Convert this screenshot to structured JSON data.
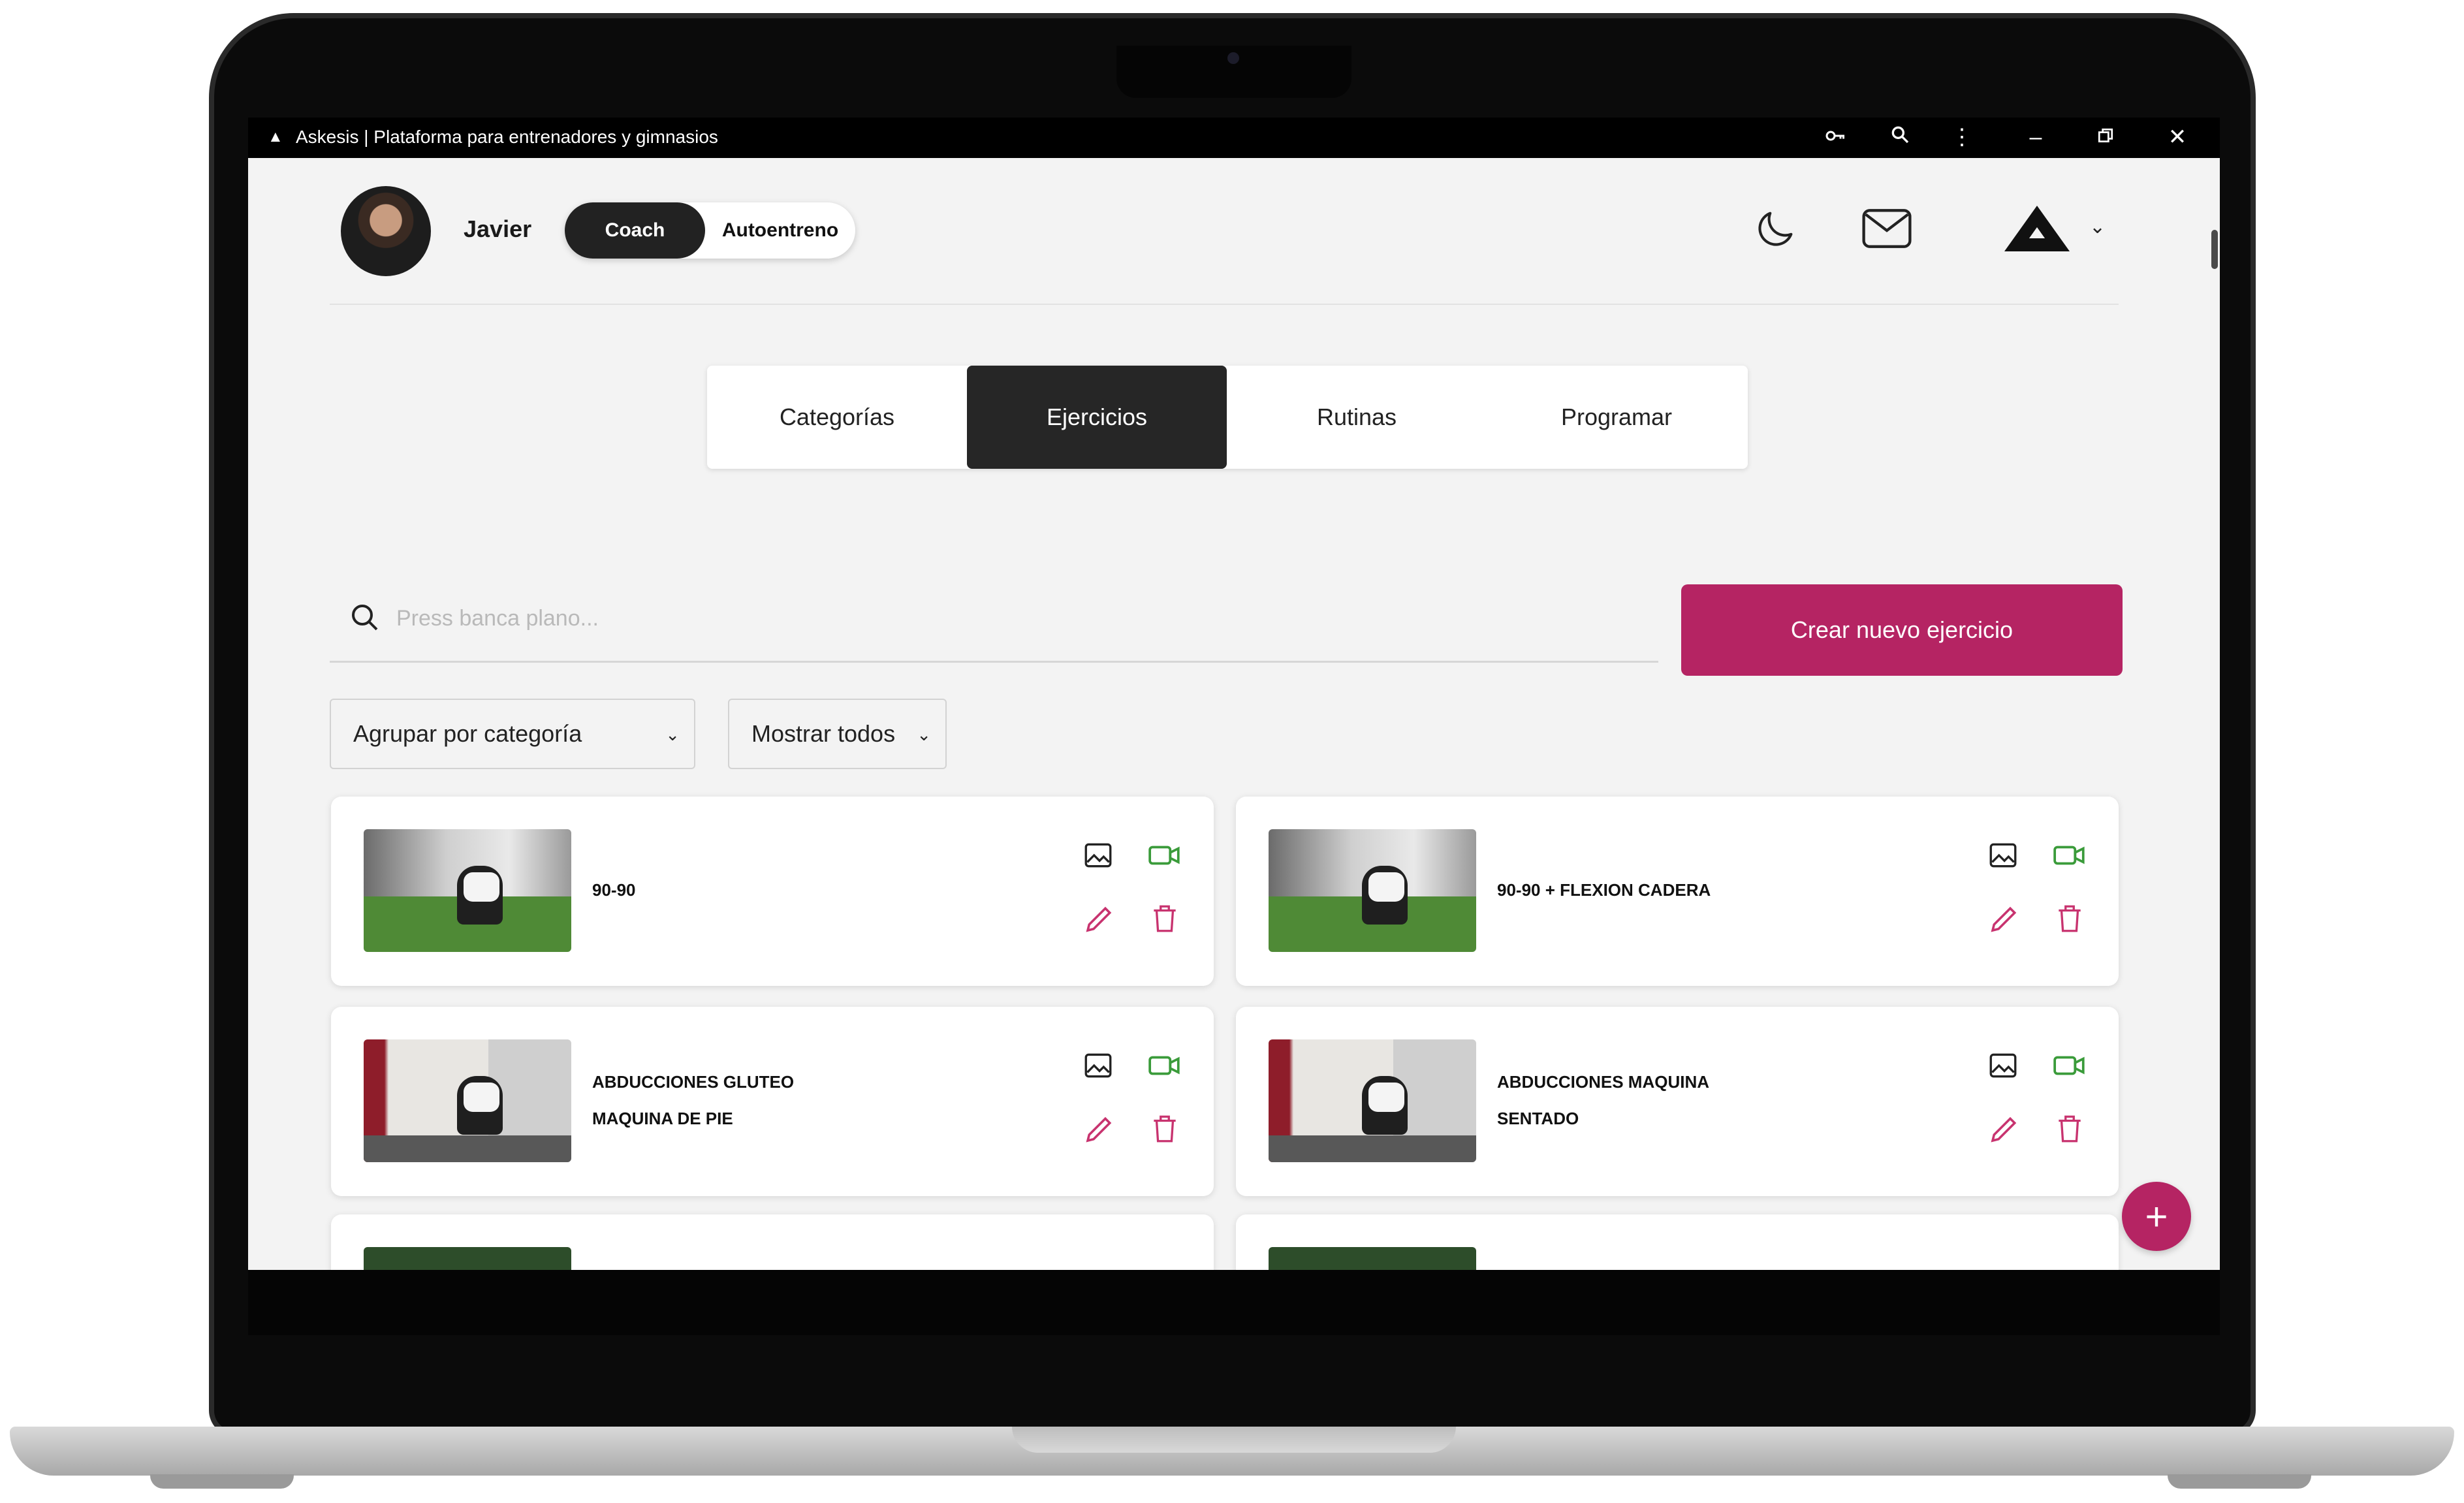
{
  "window": {
    "title": "Askesis | Plataforma para entrenadores y gimnasios",
    "controls": [
      "key-icon",
      "zoom-icon",
      "more-vert-icon",
      "minimize-icon",
      "restore-icon",
      "close-icon"
    ]
  },
  "header": {
    "user_name": "Javier",
    "mode_options": [
      "Coach",
      "Autoentreno"
    ],
    "mode_selected": "Coach",
    "icons": [
      "moon-icon",
      "mail-icon",
      "askesis-logo",
      "chevron-down-icon"
    ]
  },
  "tabs": [
    {
      "label": "Categorías",
      "active": false
    },
    {
      "label": "Ejercicios",
      "active": true
    },
    {
      "label": "Rutinas",
      "active": false
    },
    {
      "label": "Programar",
      "active": false
    }
  ],
  "search": {
    "placeholder": "Press banca plano...",
    "value": ""
  },
  "create_button": "Crear nuevo ejercicio",
  "filters": {
    "group_by": "Agrupar por categoría",
    "show": "Mostrar todos"
  },
  "exercises": [
    {
      "title_lines": [
        "90-90"
      ]
    },
    {
      "title_lines": [
        "90-90 + FLEXION CADERA"
      ]
    },
    {
      "title_lines": [
        "ABDUCCIONES GLUTEO",
        "MAQUINA DE PIE"
      ]
    },
    {
      "title_lines": [
        "ABDUCCIONES MAQUINA",
        "SENTADO"
      ]
    }
  ],
  "fab_label": "+",
  "colors": {
    "accent": "#b52463",
    "tab_active": "#262626",
    "video_icon": "#3a9b3a",
    "edit_delete_icon": "#c8336f"
  }
}
